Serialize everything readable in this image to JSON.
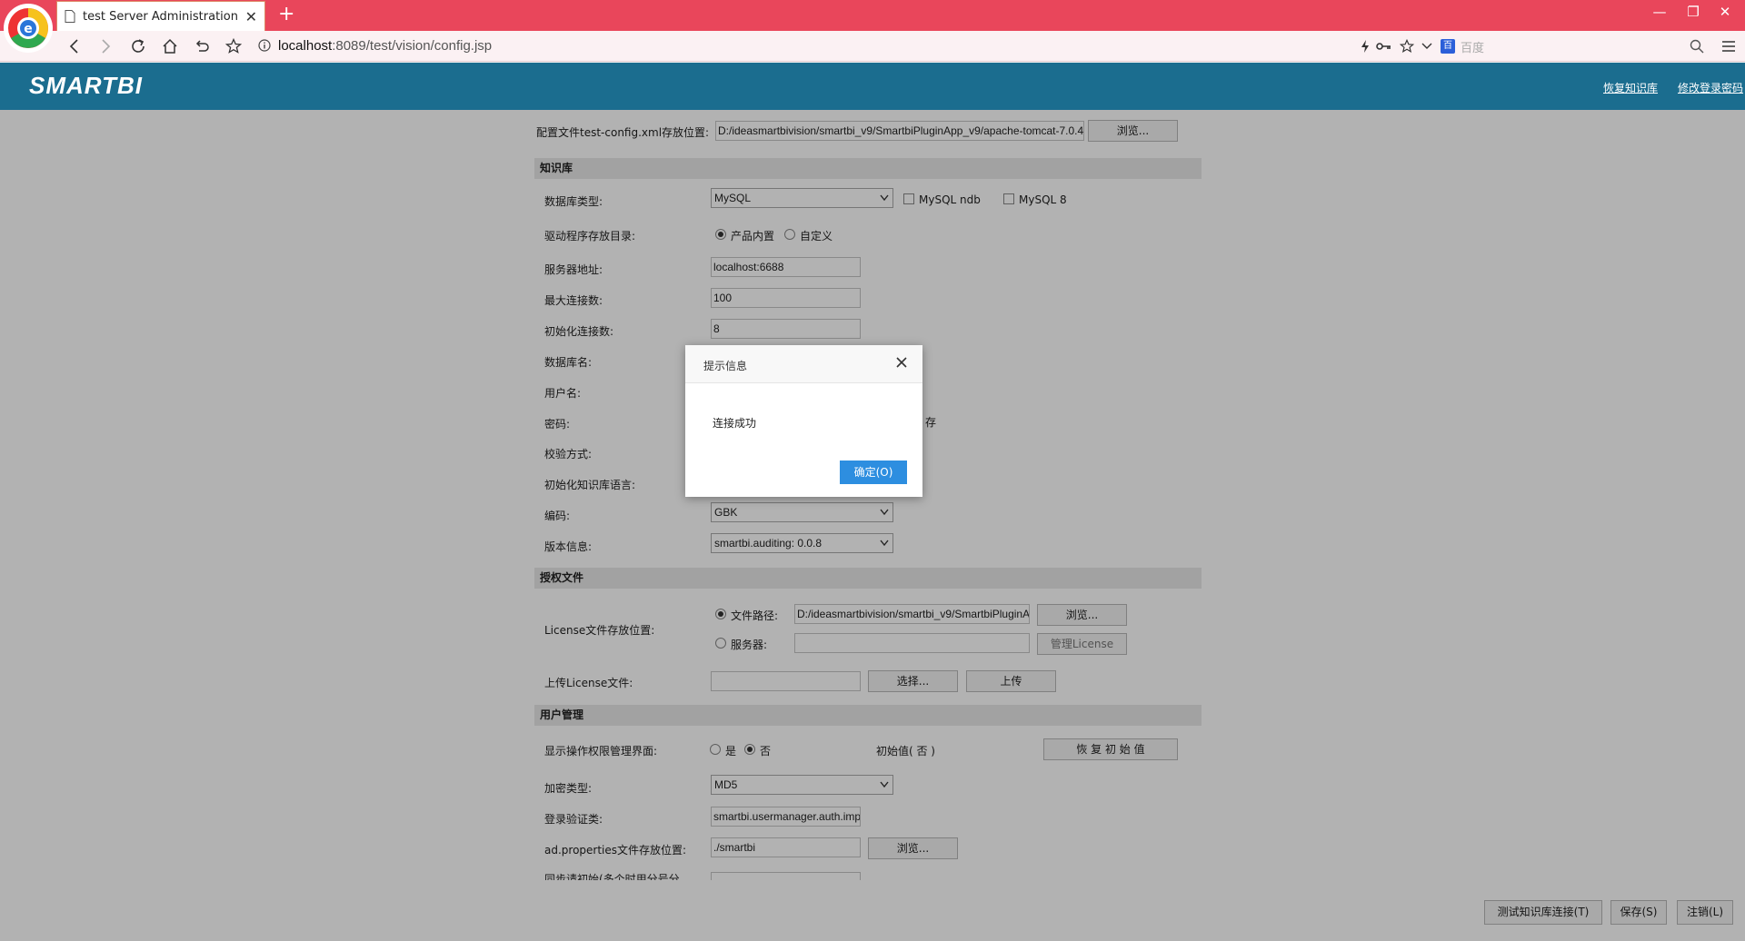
{
  "browser": {
    "tab_title": "test Server Administration Co",
    "address_host": "localhost",
    "address_path": ":8089/test/vision/config.jsp",
    "search_placeholder": "百度",
    "new_tab": "+"
  },
  "header": {
    "logo": "SMARTBI",
    "links": [
      "恢复知识库",
      "修改登录密码"
    ]
  },
  "config_file": {
    "label": "配置文件test-config.xml存放位置:",
    "value": "D:/ideasmartbivision/smartbi_v9/SmartbiPluginApp_v9/apache-tomcat-7.0.4",
    "browse": "浏览..."
  },
  "knowledge": {
    "section": "知识库",
    "db_type_label": "数据库类型:",
    "db_type_value": "MySQL",
    "mysql_ndb": "MySQL ndb",
    "mysql_8": "MySQL 8",
    "driver_label": "驱动程序存放目录:",
    "driver_builtin": "产品内置",
    "driver_custom": "自定义",
    "server_label": "服务器地址:",
    "server_value": "localhost:6688",
    "max_conn_label": "最大连接数:",
    "max_conn_value": "100",
    "init_conn_label": "初始化连接数:",
    "init_conn_value": "8",
    "dbname_label": "数据库名:",
    "user_label": "用户名:",
    "password_label": "密码:",
    "save_partial": "存",
    "validate_label": "校验方式:",
    "init_lang_label": "初始化知识库语言:",
    "encoding_label": "编码:",
    "encoding_value": "GBK",
    "version_label": "版本信息:",
    "version_value": "smartbi.auditing: 0.0.8"
  },
  "license": {
    "section": "授权文件",
    "location_label": "License文件存放位置:",
    "file_path_label": "文件路径:",
    "file_path_value": "D:/ideasmartbivision/smartbi_v9/SmartbiPluginA",
    "browse": "浏览...",
    "server_label": "服务器:",
    "manage": "管理License",
    "upload_label": "上传License文件:",
    "choose": "选择...",
    "upload": "上传"
  },
  "users": {
    "section": "用户管理",
    "show_perm_label": "显示操作权限管理界面:",
    "yes": "是",
    "no": "否",
    "init_value": "初始值( 否 )",
    "restore": "恢 复 初 始 值",
    "encrypt_label": "加密类型:",
    "encrypt_value": "MD5",
    "login_class_label": "登录验证类:",
    "login_class_value": "smartbi.usermanager.auth.imp",
    "ad_label": "ad.properties文件存放位置:",
    "ad_value": "./smartbi",
    "ad_browse": "浏览...",
    "sync_label": "同步请初始(多个时用分号分"
  },
  "footer": {
    "test_conn": "测试知识库连接(T)",
    "save": "保存(S)",
    "logout": "注销(L)"
  },
  "dialog": {
    "title": "提示信息",
    "message": "连接成功",
    "ok": "确定(O)"
  },
  "colors": {
    "titlebar": "#e9465b",
    "header": "#1b6d8f",
    "ok_button": "#2d8ee0"
  }
}
